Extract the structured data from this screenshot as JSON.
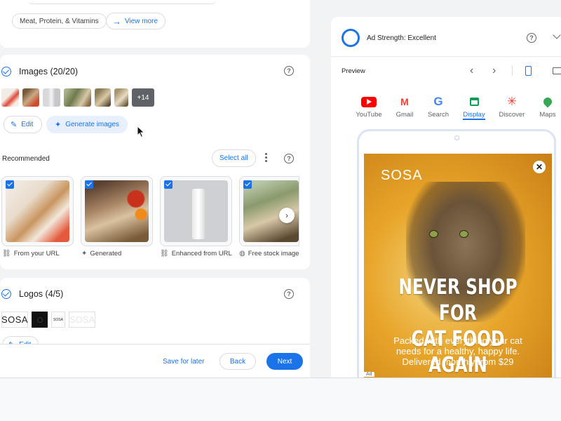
{
  "top_card": {
    "chip_label": "Meat, Protein, & Vitamins",
    "view_more_label": "View more"
  },
  "images_section": {
    "title": "Images (20/20)",
    "more_count": "+14",
    "edit_label": "Edit",
    "generate_label": "Generate images"
  },
  "recommended": {
    "title": "Recommended",
    "select_all_label": "Select all",
    "cards": [
      {
        "label": "From your URL",
        "icon": "link-icon"
      },
      {
        "label": "Generated",
        "icon": "sparkle-icon"
      },
      {
        "label": "Enhanced from URL",
        "icon": "link-sparkle-icon"
      },
      {
        "label": "Free stock image",
        "icon": "globe-icon"
      }
    ]
  },
  "logos_section": {
    "title": "Logos (4/5)",
    "edit_label": "Edit",
    "logo_text": "SOSA"
  },
  "footer": {
    "save_label": "Save for later",
    "back_label": "Back",
    "next_label": "Next"
  },
  "preview_panel": {
    "ad_strength_label": "Ad Strength: Excellent",
    "preview_label": "Preview",
    "tabs": [
      {
        "label": "YouTube",
        "icon": "youtube-icon"
      },
      {
        "label": "Gmail",
        "icon": "gmail-icon"
      },
      {
        "label": "Search",
        "icon": "google-icon"
      },
      {
        "label": "Display",
        "icon": "display-icon",
        "active": true
      },
      {
        "label": "Discover",
        "icon": "discover-icon"
      },
      {
        "label": "Maps",
        "icon": "maps-icon"
      }
    ],
    "ad": {
      "brand": "SOSA",
      "headline_line1": "NEVER SHOP FOR",
      "headline_line2": "CAT FOOD AGAIN",
      "body_line1": "Packed with everything your cat",
      "body_line2": "needs for a healthy, happy life.",
      "body_line3": "Delivered monthly from $29",
      "ad_badge": "Ad"
    }
  },
  "colors": {
    "accent": "#1a73e8",
    "ad_background": "#e8a52a"
  }
}
